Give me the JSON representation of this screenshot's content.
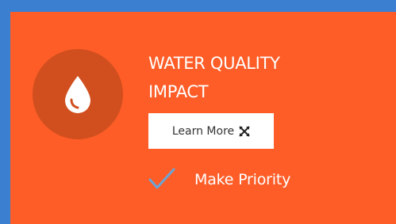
{
  "card": {
    "title_line1": "WATER QUALITY",
    "title_line2": "IMPACT",
    "icon": "water-drop-icon",
    "learn_more_label": "Learn More",
    "learn_more_icon": "expand-arrows-icon",
    "priority_label": "Make Priority",
    "priority_icon": "checkmark-icon",
    "colors": {
      "card_background": "#fe5d27",
      "icon_circle": "#d14f1e",
      "check": "#6aa5d6",
      "frame_border": "#3a7fd0"
    }
  }
}
